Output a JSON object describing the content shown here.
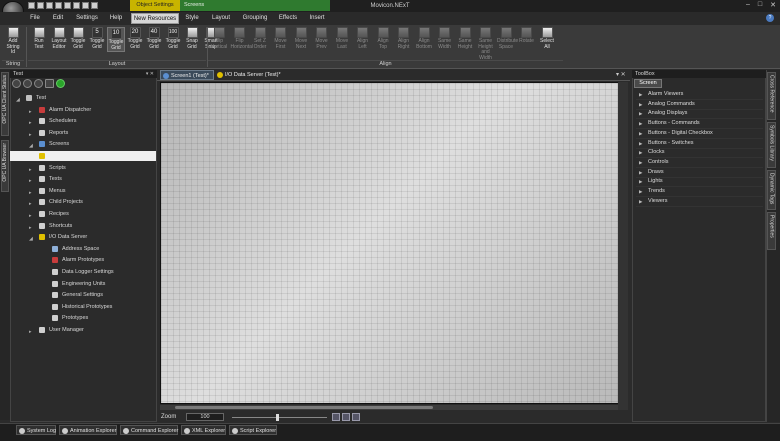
{
  "app": {
    "title": "Movicon.NExT",
    "contextual_tabs": [
      "Object Settings",
      "Screens"
    ],
    "window_controls": [
      "–",
      "□",
      "✕"
    ]
  },
  "menu": {
    "tabs": [
      "File",
      "Edit",
      "Settings",
      "Help",
      "New Resources",
      "Style",
      "Layout",
      "Grouping",
      "Effects",
      "Insert"
    ],
    "active": "New Resources",
    "help_glyph": "?"
  },
  "ribbon": {
    "string_group": {
      "label": "String",
      "button": "Add String Id"
    },
    "layout_group": {
      "label": "Layout",
      "buttons": [
        "Run Test",
        "Layout Editor",
        "Toggle Grid",
        "Toggle Grid",
        "Toggle Grid",
        "Toggle Grid",
        "Toggle Grid",
        "Toggle Grid",
        "Snap Grid",
        "Smart Snap"
      ],
      "grid_values": [
        "5",
        "10",
        "20",
        "40",
        "100"
      ]
    },
    "align_group": {
      "label": "Align",
      "buttons": [
        "Flip Vertical",
        "Flip Horizontal",
        "Set Z Order",
        "Move First",
        "Move Next",
        "Move Prev",
        "Move Last",
        "Align Left",
        "Align Top",
        "Align Right",
        "Align Bottom",
        "Same Width",
        "Same Height",
        "Same Height and Width",
        "Distribute Space",
        "Rotate",
        "Select All"
      ]
    }
  },
  "left_dock": {
    "tabs": [
      "OPC UA Client Status",
      "OPC UA Browser"
    ]
  },
  "project_explorer": {
    "title": "Test",
    "title_controls": "▾ ✕",
    "tree": [
      {
        "label": "Test",
        "level": 0,
        "expander": "◢",
        "icon_color": "#c0c0c0"
      },
      {
        "label": "Alarm Dispatcher",
        "level": 1,
        "expander": "▸",
        "icon_color": "#c83c3c"
      },
      {
        "label": "Schedulers",
        "level": 1,
        "expander": "▸",
        "icon_color": "#d0d0d0"
      },
      {
        "label": "Reports",
        "level": 1,
        "expander": "▸",
        "icon_color": "#d0d0d0"
      },
      {
        "label": "Screens",
        "level": 1,
        "expander": "◢",
        "icon_color": "#5b8fd0"
      },
      {
        "label": "",
        "level": 1,
        "expander": "",
        "icon_color": "#e0c000",
        "selected": true
      },
      {
        "label": "Scripts",
        "level": 1,
        "expander": "▸",
        "icon_color": "#d0d0d0"
      },
      {
        "label": "Texts",
        "level": 1,
        "expander": "▸",
        "icon_color": "#d0d0d0"
      },
      {
        "label": "Menus",
        "level": 1,
        "expander": "▸",
        "icon_color": "#d0d0d0"
      },
      {
        "label": "Child Projects",
        "level": 1,
        "expander": "▸",
        "icon_color": "#d0d0d0"
      },
      {
        "label": "Recipes",
        "level": 1,
        "expander": "▸",
        "icon_color": "#d0d0d0"
      },
      {
        "label": "Shortcuts",
        "level": 1,
        "expander": "▸",
        "icon_color": "#d0d0d0"
      },
      {
        "label": "I/O Data Server",
        "level": 1,
        "expander": "◢",
        "icon_color": "#e0c000"
      },
      {
        "label": "Address Space",
        "level": 2,
        "expander": "",
        "icon_color": "#8fb0d8"
      },
      {
        "label": "Alarm Prototypes",
        "level": 2,
        "expander": "",
        "icon_color": "#c83c3c"
      },
      {
        "label": "Data Logger Settings",
        "level": 2,
        "expander": "",
        "icon_color": "#d0d0d0"
      },
      {
        "label": "Engineering Units",
        "level": 2,
        "expander": "",
        "icon_color": "#d0d0d0"
      },
      {
        "label": "General Settings",
        "level": 2,
        "expander": "",
        "icon_color": "#d0d0d0"
      },
      {
        "label": "Historical Prototypes",
        "level": 2,
        "expander": "",
        "icon_color": "#d0d0d0"
      },
      {
        "label": "Prototypes",
        "level": 2,
        "expander": "",
        "icon_color": "#d0d0d0"
      },
      {
        "label": "User Manager",
        "level": 1,
        "expander": "▸",
        "icon_color": "#d0d0d0"
      }
    ]
  },
  "documents": {
    "tabs": [
      {
        "label": "Screen1 (Test)*",
        "active": true
      },
      {
        "label": "I/O Data Server (Test)*",
        "active": false
      }
    ],
    "controls": "▾ ✕"
  },
  "zoom": {
    "label": "Zoom",
    "value": "100",
    "level_percent": 46
  },
  "toolbox": {
    "title": "ToolBox",
    "tab": "Screen",
    "items": [
      "Alarm Viewers",
      "Analog Commands",
      "Analog Displays",
      "Buttons - Commands",
      "Buttons - Digital Checkbox",
      "Buttons - Switches",
      "Clocks",
      "Controls",
      "Draws",
      "Lights",
      "Trends",
      "Viewers"
    ]
  },
  "right_dock": {
    "tabs": [
      "Cross Reference",
      "Symbols Library",
      "Dynamic Tags",
      "Properties"
    ]
  },
  "status": {
    "tabs": [
      "System Log",
      "Animation Explorer",
      "Command Explorer",
      "XML Explorer",
      "Script Explorer"
    ]
  },
  "colors": {
    "accent_yellow": "#c8b400",
    "accent_green": "#2f7a2f",
    "canvas": "#c6c6c6",
    "selection": "#f0f0f0"
  }
}
